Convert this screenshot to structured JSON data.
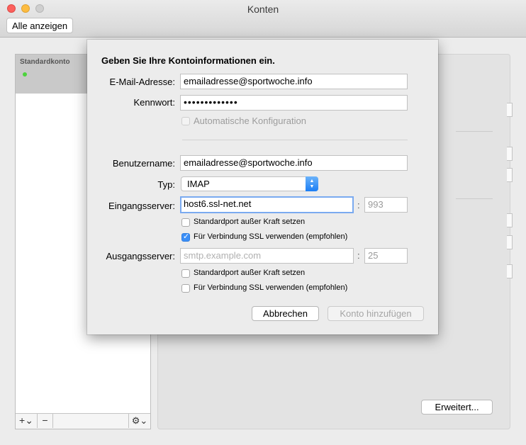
{
  "window": {
    "title": "Konten",
    "show_all_label": "Alle anzeigen"
  },
  "sidebar": {
    "header_label": "Standardkonto",
    "status_color": "#4cd43c",
    "add_icon": "plus-icon",
    "add_symbol": "+⌄",
    "remove_icon": "minus-icon",
    "remove_symbol": "−",
    "gear_icon": "gear-icon",
    "gear_symbol": "⚙⌄"
  },
  "rightpanel": {
    "advanced_label": "Erweitert..."
  },
  "sheet": {
    "heading": "Geben Sie Ihre Kontoinformationen ein.",
    "email": {
      "label": "E-Mail-Adresse:",
      "value": "emailadresse@sportwoche.info"
    },
    "password": {
      "label": "Kennwort:",
      "value": "•••••••••••••"
    },
    "auto_config": {
      "label": "Automatische Konfiguration",
      "checked": false,
      "enabled": false
    },
    "username": {
      "label": "Benutzername:",
      "value": "emailadresse@sportwoche.info"
    },
    "type": {
      "label": "Typ:",
      "value": "IMAP"
    },
    "incoming": {
      "label": "Eingangsserver:",
      "value": "host6.ssl-net.net",
      "port": "993",
      "override_port": {
        "label": "Standardport außer Kraft setzen",
        "checked": false
      },
      "use_ssl": {
        "label": "Für Verbindung SSL verwenden (empfohlen)",
        "checked": true
      }
    },
    "outgoing": {
      "label": "Ausgangsserver:",
      "placeholder": "smtp.example.com",
      "port": "25",
      "override_port": {
        "label": "Standardport außer Kraft setzen",
        "checked": false
      },
      "use_ssl": {
        "label": "Für Verbindung SSL verwenden (empfohlen)",
        "checked": false
      }
    },
    "port_separator": ":",
    "cancel_label": "Abbrechen",
    "add_label": "Konto hinzufügen",
    "accent_color": "#3b8ff7"
  }
}
